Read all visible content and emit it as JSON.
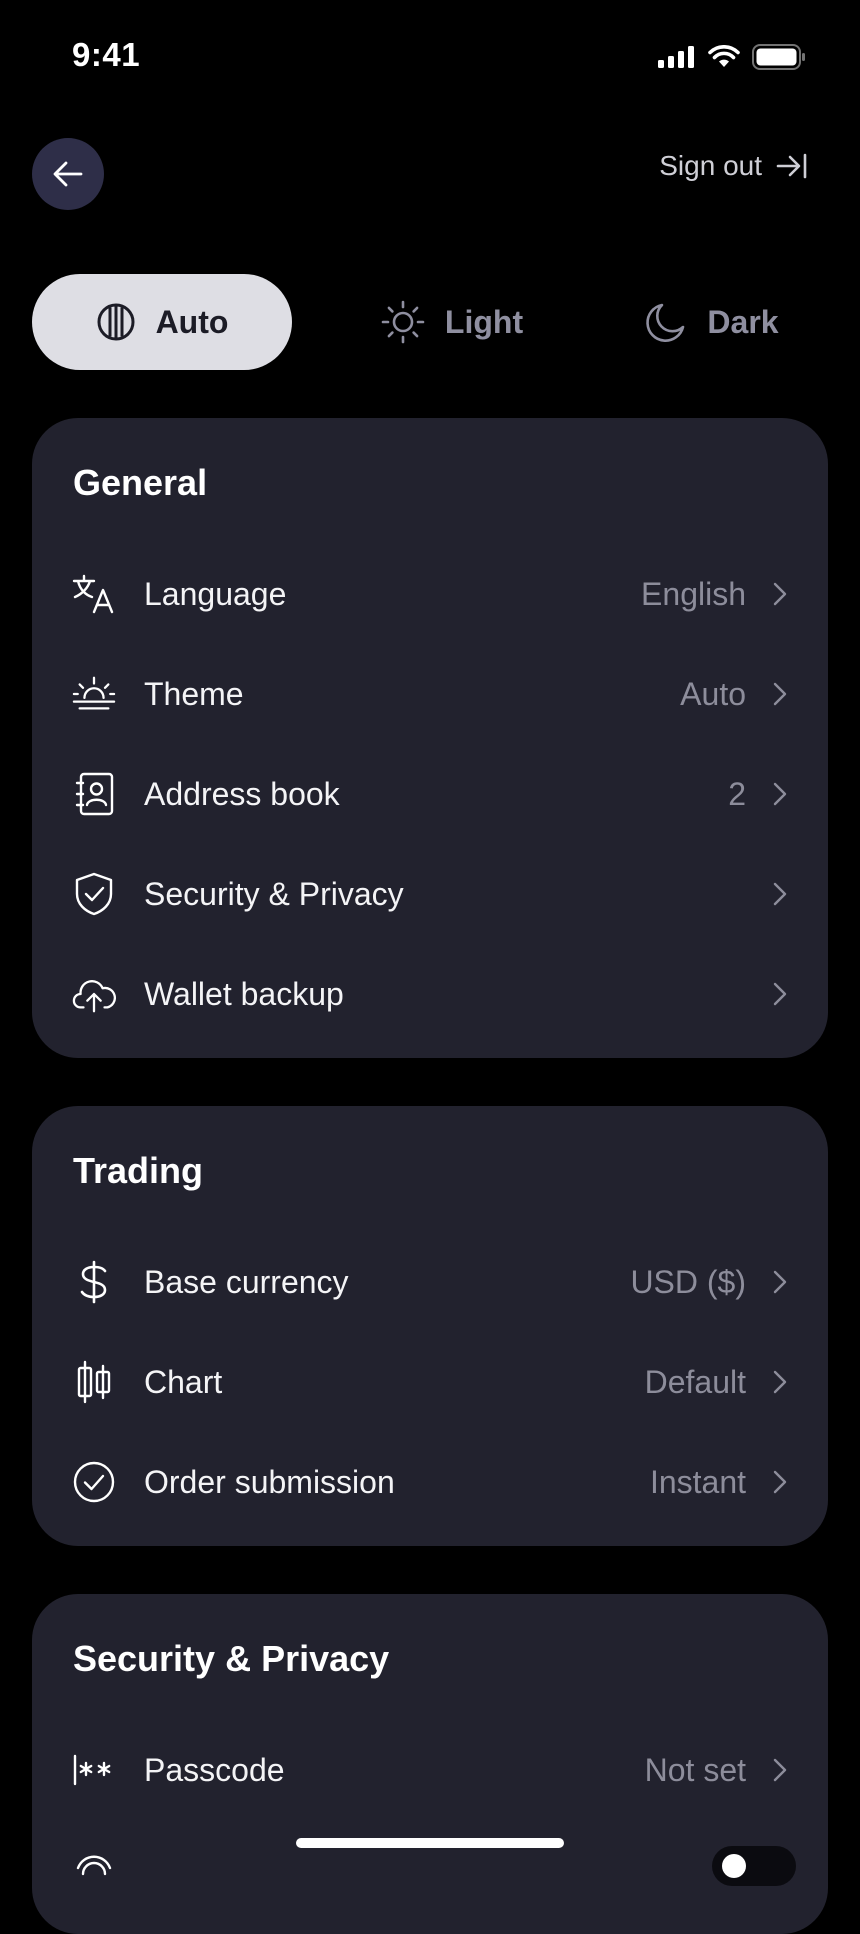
{
  "status": {
    "time": "9:41"
  },
  "header": {
    "sign_out_label": "Sign out"
  },
  "theme_switch": {
    "options": [
      {
        "label": "Auto",
        "icon": "contrast-icon",
        "selected": true
      },
      {
        "label": "Light",
        "icon": "sun-icon",
        "selected": false
      },
      {
        "label": "Dark",
        "icon": "moon-icon",
        "selected": false
      }
    ]
  },
  "general": {
    "title": "General",
    "items": [
      {
        "label": "Language",
        "value": "English",
        "icon": "translate-icon"
      },
      {
        "label": "Theme",
        "value": "Auto",
        "icon": "sunrise-icon"
      },
      {
        "label": "Address book",
        "value": "2",
        "icon": "contact-book-icon"
      },
      {
        "label": "Security & Privacy",
        "value": "",
        "icon": "shield-check-icon"
      },
      {
        "label": "Wallet backup",
        "value": "",
        "icon": "cloud-upload-icon"
      }
    ]
  },
  "trading": {
    "title": "Trading",
    "items": [
      {
        "label": "Base currency",
        "value": "USD ($)",
        "icon": "dollar-icon"
      },
      {
        "label": "Chart",
        "value": "Default",
        "icon": "candlestick-icon"
      },
      {
        "label": "Order submission",
        "value": "Instant",
        "icon": "check-circle-icon"
      }
    ]
  },
  "security": {
    "title": "Security & Privacy",
    "items": [
      {
        "label": "Passcode",
        "value": "Not set",
        "icon": "passcode-icon"
      }
    ]
  },
  "colors": {
    "background": "#000000",
    "card": "#22222e",
    "back_button": "#2e2e48",
    "selected_segment": "#dedee4",
    "muted_text": "#8d8d9b"
  }
}
